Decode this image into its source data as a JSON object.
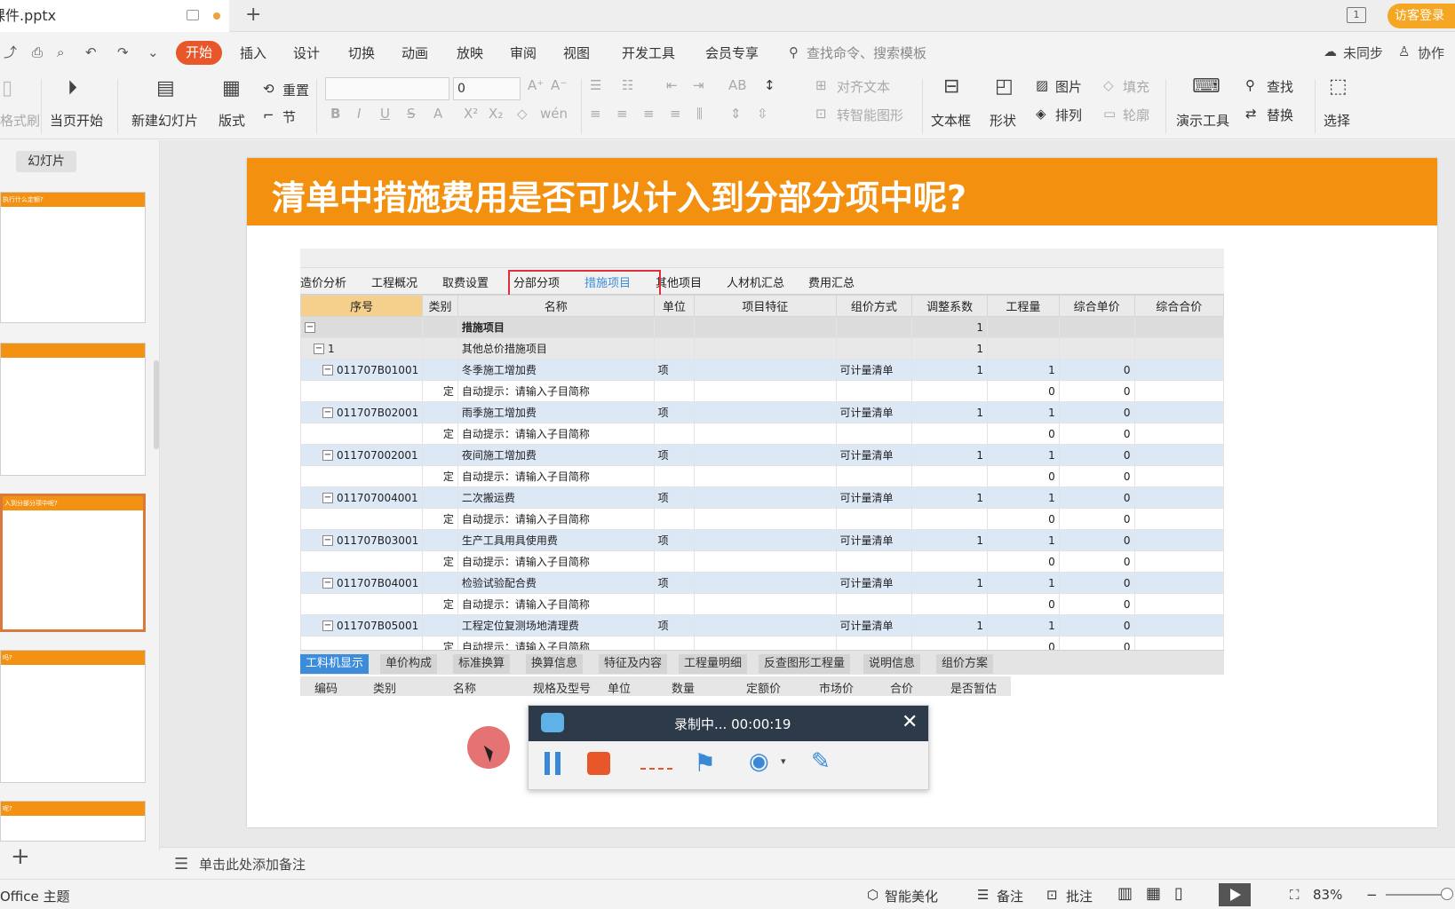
{
  "titlebar": {
    "doc_tab": "课件.pptx",
    "login": "访客登录"
  },
  "menu": {
    "active": "开始",
    "items": [
      "插入",
      "设计",
      "切换",
      "动画",
      "放映",
      "审阅",
      "视图",
      "开发工具",
      "会员专享"
    ],
    "search_placeholder": "查找命令、搜索模板",
    "sync": "未同步",
    "collab": "协作"
  },
  "ribbon": {
    "format_painter": "格式刷",
    "play_current": "当页开始",
    "new_slide": "新建幻灯片",
    "layout": "版式",
    "reset": "重置",
    "section": "节",
    "font_size": "0",
    "align_text": "对齐文本",
    "smartart": "转智能图形",
    "textbox": "文本框",
    "shape": "形状",
    "picture": "图片",
    "arrange": "排列",
    "fill": "填充",
    "outline": "轮廓",
    "present_tools": "演示工具",
    "find": "查找",
    "replace": "替换",
    "select": "选择"
  },
  "leftpanel": {
    "tab": "幻灯片",
    "thumbs": [
      {
        "title": "执行什么定额?"
      },
      {
        "title": ""
      },
      {
        "title": "入到分部分项中呢?"
      },
      {
        "title": "吗?"
      },
      {
        "title": "呢?"
      }
    ]
  },
  "slide": {
    "title": "清单中措施费用是否可以计入到分部分项中呢?",
    "sw_tabs": [
      "造价分析",
      "工程概况",
      "取费设置",
      "分部分项",
      "措施项目",
      "其他项目",
      "人材机汇总",
      "费用汇总"
    ],
    "columns": [
      "序号",
      "类别",
      "名称",
      "单位",
      "项目特征",
      "组价方式",
      "调整系数",
      "工程量",
      "综合单价",
      "综合合价"
    ],
    "rows": [
      {
        "type": "head",
        "seq": "",
        "cat": "",
        "name": "措施项目",
        "unit": "",
        "feat": "",
        "method": "",
        "coef": "1",
        "qty": "",
        "price": ""
      },
      {
        "type": "sub",
        "seq": "1",
        "cat": "",
        "name": "其他总价措施项目",
        "unit": "",
        "feat": "",
        "method": "",
        "coef": "1",
        "qty": "",
        "price": ""
      },
      {
        "type": "item",
        "seq": "011707B01001",
        "cat": "",
        "name": "冬季施工增加费",
        "unit": "项",
        "feat": "",
        "method": "可计量清单",
        "coef": "1",
        "qty": "1",
        "price": "0"
      },
      {
        "type": "ding",
        "seq": "",
        "cat": "定",
        "name": "自动提示：请输入子目简称",
        "unit": "",
        "feat": "",
        "method": "",
        "coef": "",
        "qty": "0",
        "price": "0"
      },
      {
        "type": "item",
        "seq": "011707B02001",
        "cat": "",
        "name": "雨季施工增加费",
        "unit": "项",
        "feat": "",
        "method": "可计量清单",
        "coef": "1",
        "qty": "1",
        "price": "0"
      },
      {
        "type": "ding",
        "seq": "",
        "cat": "定",
        "name": "自动提示：请输入子目简称",
        "unit": "",
        "feat": "",
        "method": "",
        "coef": "",
        "qty": "0",
        "price": "0"
      },
      {
        "type": "item",
        "seq": "011707002001",
        "cat": "",
        "name": "夜间施工增加费",
        "unit": "项",
        "feat": "",
        "method": "可计量清单",
        "coef": "1",
        "qty": "1",
        "price": "0"
      },
      {
        "type": "ding",
        "seq": "",
        "cat": "定",
        "name": "自动提示：请输入子目简称",
        "unit": "",
        "feat": "",
        "method": "",
        "coef": "",
        "qty": "0",
        "price": "0"
      },
      {
        "type": "item",
        "seq": "011707004001",
        "cat": "",
        "name": "二次搬运费",
        "unit": "项",
        "feat": "",
        "method": "可计量清单",
        "coef": "1",
        "qty": "1",
        "price": "0"
      },
      {
        "type": "ding",
        "seq": "",
        "cat": "定",
        "name": "自动提示：请输入子目简称",
        "unit": "",
        "feat": "",
        "method": "",
        "coef": "",
        "qty": "0",
        "price": "0"
      },
      {
        "type": "item",
        "seq": "011707B03001",
        "cat": "",
        "name": "生产工具用具使用费",
        "unit": "项",
        "feat": "",
        "method": "可计量清单",
        "coef": "1",
        "qty": "1",
        "price": "0"
      },
      {
        "type": "ding",
        "seq": "",
        "cat": "定",
        "name": "自动提示：请输入子目简称",
        "unit": "",
        "feat": "",
        "method": "",
        "coef": "",
        "qty": "0",
        "price": "0"
      },
      {
        "type": "item",
        "seq": "011707B04001",
        "cat": "",
        "name": "检验试验配合费",
        "unit": "项",
        "feat": "",
        "method": "可计量清单",
        "coef": "1",
        "qty": "1",
        "price": "0"
      },
      {
        "type": "ding",
        "seq": "",
        "cat": "定",
        "name": "自动提示：请输入子目简称",
        "unit": "",
        "feat": "",
        "method": "",
        "coef": "",
        "qty": "0",
        "price": "0"
      },
      {
        "type": "item",
        "seq": "011707B05001",
        "cat": "",
        "name": "工程定位复测场地清理费",
        "unit": "项",
        "feat": "",
        "method": "可计量清单",
        "coef": "1",
        "qty": "1",
        "price": "0"
      },
      {
        "type": "ding",
        "seq": "",
        "cat": "定",
        "name": "自动提示：请输入子目简称",
        "unit": "",
        "feat": "",
        "method": "",
        "coef": "",
        "qty": "0",
        "price": "0"
      }
    ],
    "bottom_tabs": [
      "工料机显示",
      "单价构成",
      "标准换算",
      "换算信息",
      "特征及内容",
      "工程量明细",
      "反查图形工程量",
      "说明信息",
      "组价方案"
    ],
    "bottom_cols": [
      "编码",
      "类别",
      "名称",
      "规格及型号",
      "单位",
      "数量",
      "定额价",
      "市场价",
      "合价",
      "是否暂估"
    ]
  },
  "recorder": {
    "status": "录制中... 00:00:19"
  },
  "notes": {
    "placeholder": "单击此处添加备注"
  },
  "statusbar": {
    "theme": "Office 主题",
    "beautify": "智能美化",
    "notes": "备注",
    "comment": "批注",
    "zoom": "83%"
  },
  "colors": {
    "accent": "#f4900f",
    "menu_active": "#e8572a",
    "link_blue": "#3c8cdc",
    "highlight_red": "#e0303a"
  }
}
